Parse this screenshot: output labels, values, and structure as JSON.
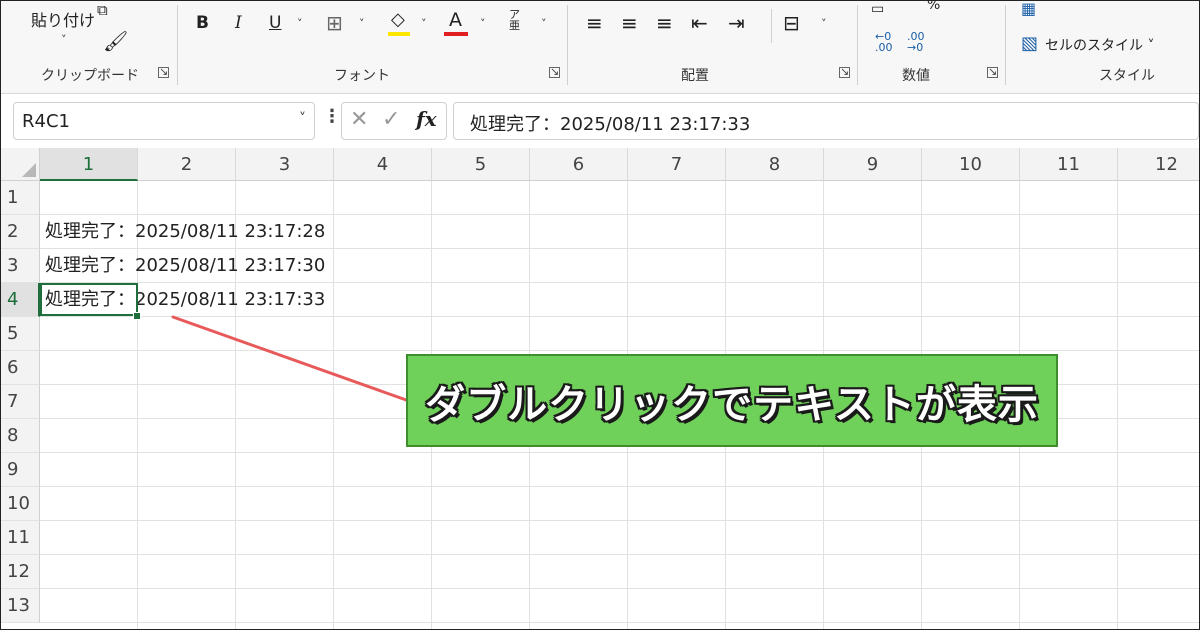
{
  "ribbon": {
    "clipboard": {
      "paste_label": "貼り付け",
      "group_label": "クリップボード"
    },
    "font": {
      "bold": "B",
      "italic": "I",
      "underline": "U",
      "font_color_letter": "A",
      "phonetic": "ア亜",
      "group_label": "フォント",
      "highlight_color": "#ffe600",
      "font_color": "#e02020"
    },
    "alignment": {
      "group_label": "配置"
    },
    "number": {
      "group_label": "数値",
      "inc_decimal": "←0 .00",
      "dec_decimal": ".00 →0"
    },
    "styles": {
      "cell_styles_label": "セルのスタイル ˅",
      "group_label": "スタイル"
    }
  },
  "formula_bar": {
    "name_box": "R4C1",
    "fx": "fx",
    "formula": "処理完了：2025/08/11 23:17:33"
  },
  "sheet": {
    "columns": [
      "1",
      "2",
      "3",
      "4",
      "5",
      "6",
      "7",
      "8",
      "9",
      "10",
      "11",
      "12"
    ],
    "rows": [
      "1",
      "2",
      "3",
      "4",
      "5",
      "6",
      "7",
      "8",
      "9",
      "10",
      "11",
      "12",
      "13"
    ],
    "cells": [
      {
        "row": "2",
        "text": "処理完了：2025/08/11 23:17:28"
      },
      {
        "row": "3",
        "text": "処理完了：2025/08/11 23:17:30"
      },
      {
        "row": "4",
        "text": "処理完了：2025/08/11 23:17:33"
      }
    ],
    "selected_col": "1",
    "selected_row": "4"
  },
  "annotation": {
    "text": "ダブルクリックでテキストが表示",
    "arrow_color": "#e85a5a",
    "box_color": "#6fd05a"
  }
}
